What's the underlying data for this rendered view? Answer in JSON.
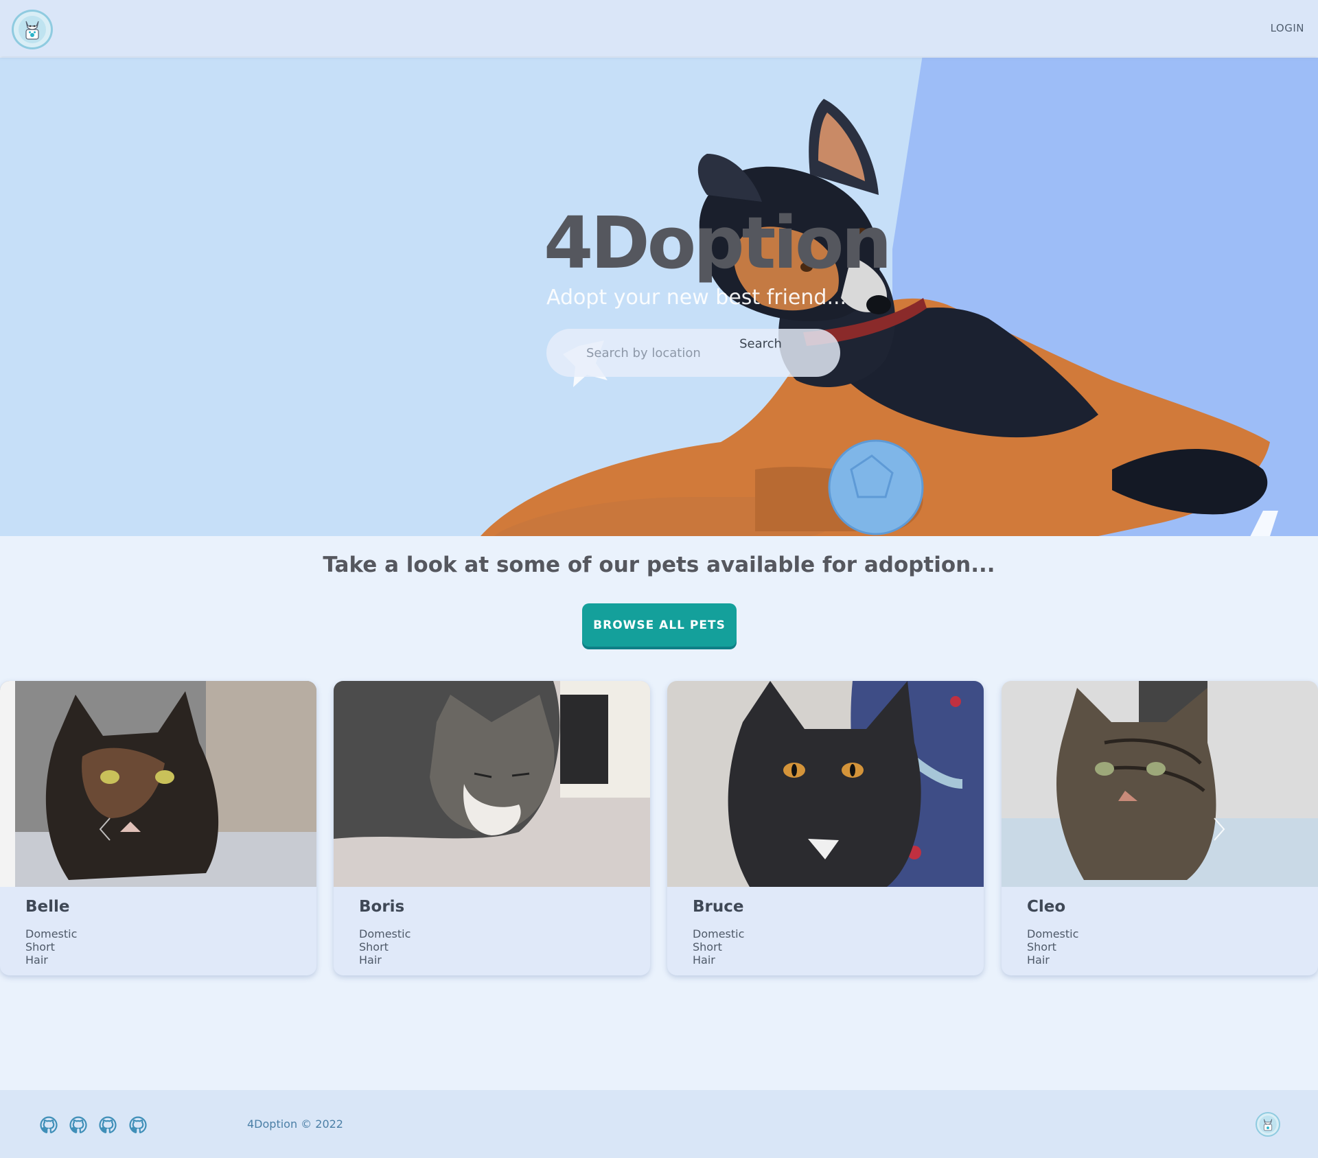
{
  "navbar": {
    "logo_icon": "cat-paw-logo-icon",
    "login_label": "LOGIN"
  },
  "hero": {
    "title": "4Doption",
    "subtitle": "Adopt your new best friend...",
    "search_placeholder": "Search by location",
    "search_value": "",
    "search_button_label": "Search"
  },
  "main": {
    "heading": "Take a look at some of our pets available for adoption...",
    "browse_button_label": "BROWSE ALL PETS",
    "pets": [
      {
        "name": "Belle",
        "breed": "Domestic Short Hair"
      },
      {
        "name": "Boris",
        "breed": "Domestic Short Hair"
      },
      {
        "name": "Bruce",
        "breed": "Domestic Short Hair"
      },
      {
        "name": "Cleo",
        "breed": "Domestic Short Hair"
      }
    ]
  },
  "footer": {
    "copyright": "4Doption © 2022",
    "social_icons": [
      "github-icon",
      "github-icon",
      "github-icon",
      "github-icon"
    ]
  },
  "colors": {
    "accent": "#14a09b",
    "navbar_bg": "#dae6f8",
    "hero_bg": "#c6dff8",
    "page_bg": "#eaf2fc",
    "footer_bg": "#d9e6f7",
    "card_bg": "#e0e9f9"
  }
}
